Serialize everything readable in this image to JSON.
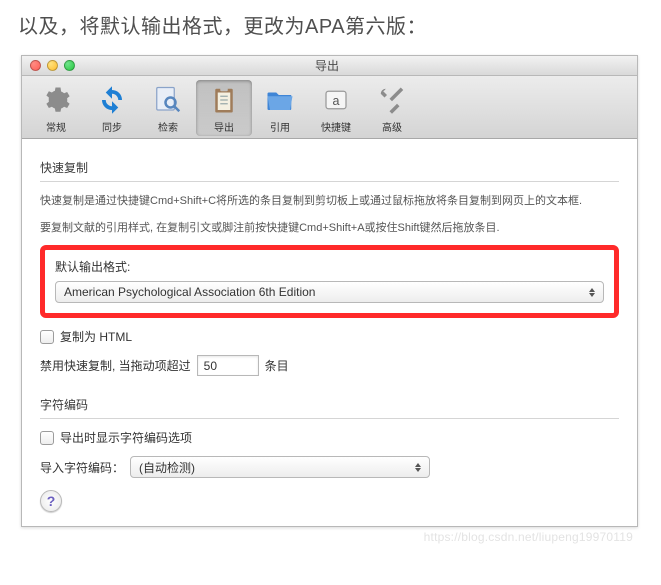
{
  "lead_text": "以及，将默认输出格式，更改为APA第六版：",
  "window_title": "导出",
  "toolbar": [
    {
      "name": "general",
      "label": "常规"
    },
    {
      "name": "sync",
      "label": "同步"
    },
    {
      "name": "search",
      "label": "检索"
    },
    {
      "name": "export",
      "label": "导出",
      "selected": true
    },
    {
      "name": "cite",
      "label": "引用"
    },
    {
      "name": "shortcut",
      "label": "快捷键"
    },
    {
      "name": "advanced",
      "label": "高级"
    }
  ],
  "quickcopy": {
    "header": "快速复制",
    "desc1": "快速复制是通过快捷键Cmd+Shift+C将所选的条目复制到剪切板上或通过鼠标拖放将条目复制到网页上的文本框.",
    "desc2": "要复制文献的引用样式, 在复制引文或脚注前按快捷键Cmd+Shift+A或按住Shift键然后拖放条目.",
    "output_label": "默认输出格式:",
    "output_value": "American Psychological Association 6th Edition",
    "copy_html_label": "复制为 HTML",
    "disable_drag_label": "禁用快速复制, 当拖动项超过",
    "disable_drag_value": "50",
    "disable_drag_suffix": "条目"
  },
  "charenc": {
    "header": "字符编码",
    "show_opts_label": "导出时显示字符编码选项",
    "import_label": "导入字符编码：",
    "import_value": "(自动检测)"
  },
  "watermark": "https://blog.csdn.net/liupeng19970119"
}
